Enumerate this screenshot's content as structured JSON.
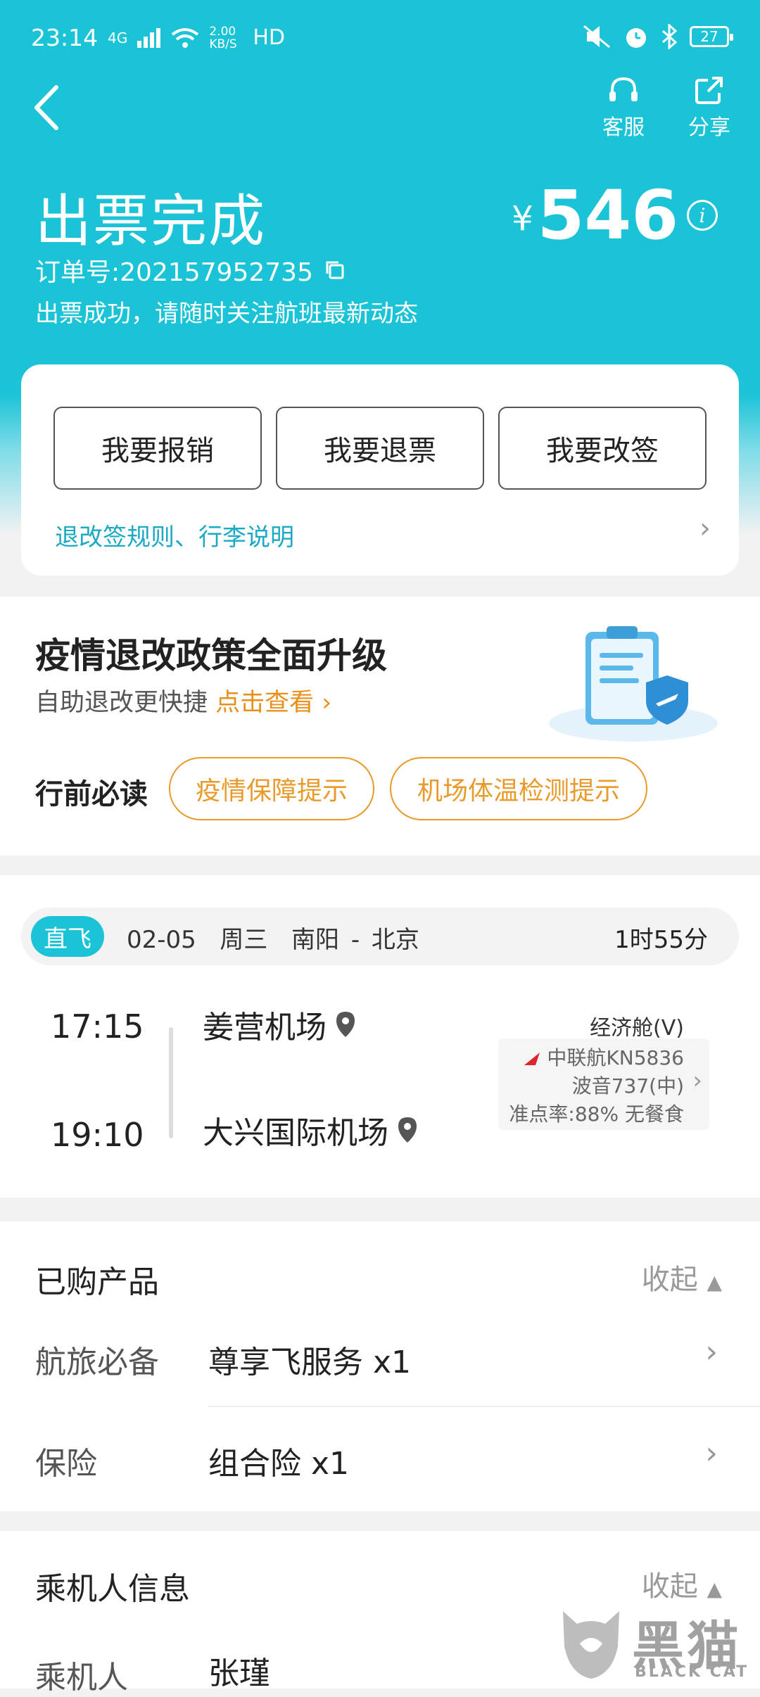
{
  "statusbar": {
    "time": "23:14",
    "network": "4G",
    "speed": "2.00 KB/S",
    "hd": "HD",
    "battery": "27"
  },
  "colors": {
    "primary": "#1bc3d6",
    "accent_orange": "#e89a2a",
    "link_teal": "#1ba9c4"
  },
  "header": {
    "back_icon": "back-arrow-icon",
    "service_label": "客服",
    "share_label": "分享",
    "title": "出票完成",
    "price_symbol": "¥",
    "price": "546",
    "order_no": "订单号:202157952735",
    "subtitle": "出票成功，请随时关注航班最新动态"
  },
  "actions": {
    "reimburse": "我要报销",
    "refund": "我要退票",
    "change": "我要改签",
    "rules_link": "退改签规则、行李说明"
  },
  "policy": {
    "heading": "疫情退改政策全面升级",
    "sub": "自助退改更快捷",
    "view_link": "点击查看",
    "must_read": "行前必读",
    "tip1": "疫情保障提示",
    "tip2": "机场体温检测提示"
  },
  "flight": {
    "tag": "直飞",
    "date": "02-05",
    "weekday": "周三",
    "route": "南阳 - 北京",
    "duration": "1时55分",
    "dep_time": "17:15",
    "arr_time": "19:10",
    "dep_airport": "姜营机场",
    "arr_airport": "大兴国际机场",
    "cabin": "经济舱(V)",
    "airline": "中联航KN5836",
    "aircraft": "波音737(中)",
    "punctuality": "准点率:88% 无餐食"
  },
  "products": {
    "title": "已购产品",
    "collapse": "收起",
    "rows": [
      {
        "label": "航旅必备",
        "value": "尊享飞服务 x1"
      },
      {
        "label": "保险",
        "value": "组合险 x1"
      }
    ]
  },
  "passenger": {
    "title": "乘机人信息",
    "collapse": "收起",
    "label": "乘机人",
    "name": "张瑾"
  },
  "watermark": {
    "cn": "黑猫",
    "en": "BLACK CAT"
  }
}
